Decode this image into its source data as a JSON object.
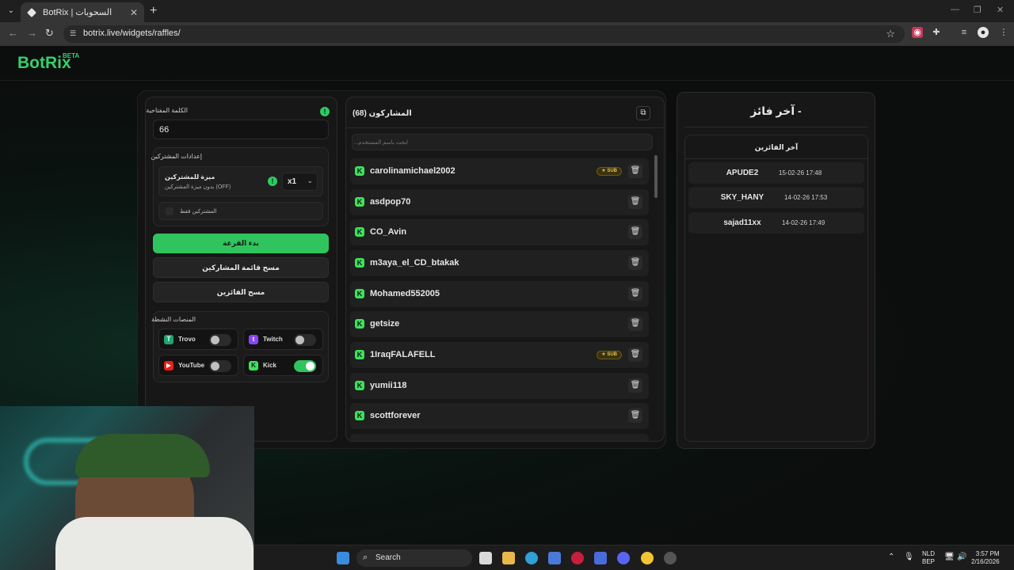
{
  "browser": {
    "tab_title": "BotRix | السحوبات",
    "url": "botrix.live/widgets/raffles/"
  },
  "header": {
    "logo": "BotRix",
    "badge": "BETA"
  },
  "left_panel": {
    "keyword_label": "الكلمة المفتاحية",
    "keyword_value": "66",
    "participant_settings_label": "إعدادات المشتركين",
    "sub_perk_title": "ميزة للمشتركين",
    "sub_perk_sub": "بدون ميزة المشتركين (OFF)",
    "multiplier": "x1",
    "subs_only_label": "المشتركين فقط",
    "start_button": "بدء القرعة",
    "clear_participants_button": "مسح قائمة المشاركين",
    "clear_winners_button": "مسح الفائزين",
    "active_platforms_label": "المنصات النشطة",
    "platforms": [
      {
        "name": "Trovo",
        "on": false
      },
      {
        "name": "Twitch",
        "on": false
      },
      {
        "name": "YouTube",
        "on": false
      },
      {
        "name": "Kick",
        "on": true
      }
    ]
  },
  "participants": {
    "title": "المشاركون (68)",
    "search_placeholder": "ابحث باسم المستخدم...",
    "sub_badge": "SUB",
    "rows": [
      {
        "name": "carolinamichael2002",
        "sub": true
      },
      {
        "name": "asdpop70",
        "sub": false
      },
      {
        "name": "CO_Avin",
        "sub": false
      },
      {
        "name": "m3aya_el_CD_btakak",
        "sub": false
      },
      {
        "name": "Mohamed552005",
        "sub": false
      },
      {
        "name": "getsize",
        "sub": false
      },
      {
        "name": "1IraqFALAFELL",
        "sub": true
      },
      {
        "name": "yumii118",
        "sub": false
      },
      {
        "name": "scottforever",
        "sub": false
      }
    ]
  },
  "winners": {
    "heading": "- آخر فائز",
    "list_title": "آخر الفائزين",
    "rows": [
      {
        "name": "APUDE2",
        "date": "15-02-26 17:48"
      },
      {
        "name": "SKY_HANY",
        "date": "14-02-26 17:53"
      },
      {
        "name": "sajad11xx",
        "date": "14-02-26 17:49"
      }
    ]
  },
  "taskbar": {
    "search": "Search",
    "lang_top": "NLD",
    "lang_bottom": "BEP",
    "time": "3:57 PM",
    "date": "2/16/2026"
  },
  "colors": {
    "accent": "#2fc45e",
    "kick": "#3de35a",
    "sub_badge": "#e2c24a"
  }
}
